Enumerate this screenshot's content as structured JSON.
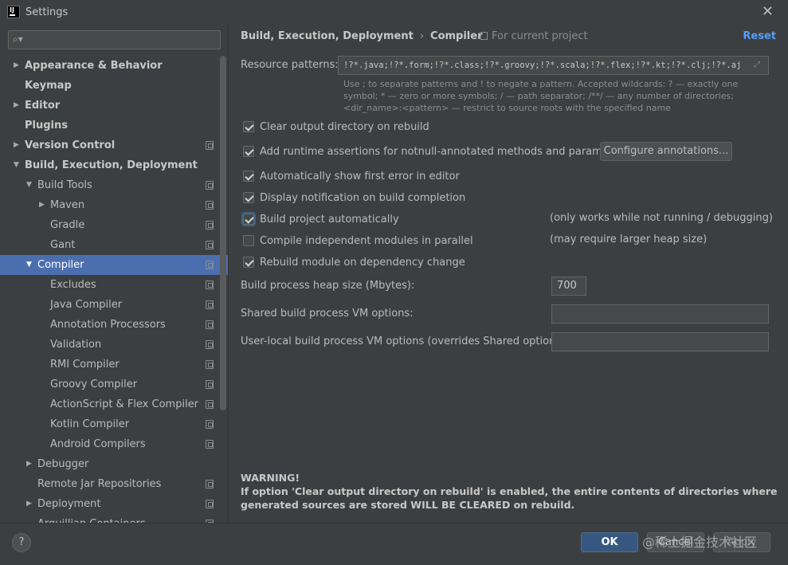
{
  "window": {
    "title": "Settings",
    "close_glyph": "✕"
  },
  "search": {
    "placeholder": "",
    "icon": "search-icon"
  },
  "tree": [
    {
      "label": "Appearance & Behavior",
      "level": 0,
      "arrow": "▶",
      "bold": true,
      "copy": false
    },
    {
      "label": "Keymap",
      "level": 0,
      "arrow": "",
      "bold": true,
      "copy": false
    },
    {
      "label": "Editor",
      "level": 0,
      "arrow": "▶",
      "bold": true,
      "copy": false
    },
    {
      "label": "Plugins",
      "level": 0,
      "arrow": "",
      "bold": true,
      "copy": false
    },
    {
      "label": "Version Control",
      "level": 0,
      "arrow": "▶",
      "bold": true,
      "copy": true
    },
    {
      "label": "Build, Execution, Deployment",
      "level": 0,
      "arrow": "▼",
      "bold": true,
      "copy": false
    },
    {
      "label": "Build Tools",
      "level": 1,
      "arrow": "▼",
      "bold": false,
      "copy": true
    },
    {
      "label": "Maven",
      "level": 2,
      "arrow": "▶",
      "bold": false,
      "copy": true
    },
    {
      "label": "Gradle",
      "level": 2,
      "arrow": "",
      "bold": false,
      "copy": true
    },
    {
      "label": "Gant",
      "level": 2,
      "arrow": "",
      "bold": false,
      "copy": true
    },
    {
      "label": "Compiler",
      "level": 1,
      "arrow": "▼",
      "bold": false,
      "copy": true,
      "selected": true
    },
    {
      "label": "Excludes",
      "level": 2,
      "arrow": "",
      "bold": false,
      "copy": true
    },
    {
      "label": "Java Compiler",
      "level": 2,
      "arrow": "",
      "bold": false,
      "copy": true
    },
    {
      "label": "Annotation Processors",
      "level": 2,
      "arrow": "",
      "bold": false,
      "copy": true
    },
    {
      "label": "Validation",
      "level": 2,
      "arrow": "",
      "bold": false,
      "copy": true
    },
    {
      "label": "RMI Compiler",
      "level": 2,
      "arrow": "",
      "bold": false,
      "copy": true
    },
    {
      "label": "Groovy Compiler",
      "level": 2,
      "arrow": "",
      "bold": false,
      "copy": true
    },
    {
      "label": "ActionScript & Flex Compiler",
      "level": 2,
      "arrow": "",
      "bold": false,
      "copy": true
    },
    {
      "label": "Kotlin Compiler",
      "level": 2,
      "arrow": "",
      "bold": false,
      "copy": true
    },
    {
      "label": "Android Compilers",
      "level": 2,
      "arrow": "",
      "bold": false,
      "copy": true
    },
    {
      "label": "Debugger",
      "level": 1,
      "arrow": "▶",
      "bold": false,
      "copy": false
    },
    {
      "label": "Remote Jar Repositories",
      "level": 1,
      "arrow": "",
      "bold": false,
      "copy": true
    },
    {
      "label": "Deployment",
      "level": 1,
      "arrow": "▶",
      "bold": false,
      "copy": true
    },
    {
      "label": "Arquillian Containers",
      "level": 1,
      "arrow": "",
      "bold": false,
      "copy": true
    }
  ],
  "breadcrumb": {
    "parent": "Build, Execution, Deployment",
    "sep": "›",
    "current": "Compiler"
  },
  "scope_label": "For current project",
  "reset_label": "Reset",
  "resource_patterns": {
    "label": "Resource patterns:",
    "value": "!?*.java;!?*.form;!?*.class;!?*.groovy;!?*.scala;!?*.flex;!?*.kt;!?*.clj;!?*.aj",
    "hint": "Use ; to separate patterns and ! to negate a pattern. Accepted wildcards: ? — exactly one symbol; * — zero or more symbols; / — path separator; /**/ — any number of directories; <dir_name>:<pattern> — restrict to source roots with the specified name"
  },
  "options": [
    {
      "label": "Clear output directory on rebuild",
      "checked": true
    },
    {
      "label": "Add runtime assertions for notnull-annotated methods and parameters",
      "checked": true
    },
    {
      "label": "Automatically show first error in editor",
      "checked": true
    },
    {
      "label": "Display notification on build completion",
      "checked": true
    },
    {
      "label": "Build project automatically",
      "checked": true,
      "note": "(only works while not running / debugging)"
    },
    {
      "label": "Compile independent modules in parallel",
      "checked": false,
      "note": "(may require larger heap size)"
    },
    {
      "label": "Rebuild module on dependency change",
      "checked": true
    }
  ],
  "configure_annotations_label": "Configure annotations...",
  "heap": {
    "label": "Build process heap size (Mbytes):",
    "value": "700"
  },
  "shared_vm": {
    "label": "Shared build process VM options:",
    "value": ""
  },
  "user_vm": {
    "label": "User-local build process VM options (overrides Shared options):",
    "value": ""
  },
  "warning": {
    "title": "WARNING!",
    "text": "If option 'Clear output directory on rebuild' is enabled, the entire contents of directories where generated sources are stored WILL BE CLEARED on rebuild."
  },
  "buttons": {
    "help": "?",
    "ok": "OK",
    "cancel": "Cancel",
    "apply": "Apply"
  },
  "watermark": "@稀土掘金技术社区",
  "colors": {
    "selection": "#4b6eaf",
    "link": "#589df6",
    "ok_button": "#365880",
    "background": "#3c3f41"
  }
}
